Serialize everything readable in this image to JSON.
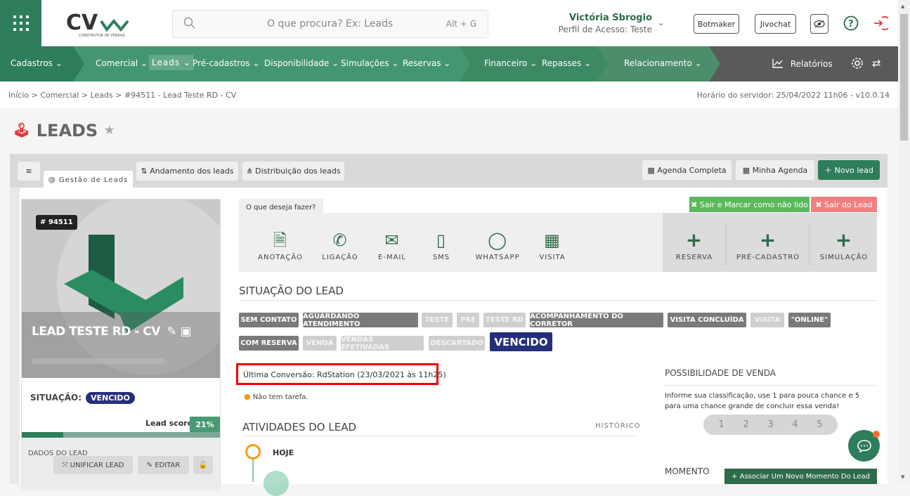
{
  "search": {
    "placeholder": "O que procura? Ex: Leads",
    "shortcut": "Alt + G"
  },
  "user": {
    "name": "Victória Sbrogio",
    "profile": "Perfil de Acesso: Teste"
  },
  "top_buttons": {
    "botmaker": "Botmaker",
    "jivochat": "Jivochat"
  },
  "nav": {
    "items": [
      "Cadastros",
      "Comercial",
      "Leads",
      "Pré-cadastros",
      "Disponibilidade",
      "Simulações",
      "Reservas",
      "Financeiro",
      "Repasses",
      "Relacionamento"
    ],
    "reports": "Relatórios"
  },
  "breadcrumb": {
    "path": "Início   >   Comercial   >   Leads   >   #94511 - Lead Teste RD - CV",
    "server": "Horário do servidor: 25/04/2022 11h06 - v10.0.14"
  },
  "page_title": "LEADS",
  "tabs": {
    "menu": "≡",
    "gestao": "@ Gestão de Leads",
    "andamento": "Andamento dos leads",
    "distribuicao": "Distribuição dos leads",
    "agenda": "Agenda Completa",
    "minha": "Minha Agenda",
    "novo": "Novo lead"
  },
  "lead": {
    "id": "# 94511",
    "name": "LEAD TESTE RD - CV",
    "situation_label": "SITUAÇÃO:",
    "situation": "VENCIDO",
    "score_label": "Lead score",
    "score": "21%",
    "score_value": 0.21,
    "section": "DADOS DO LEAD",
    "unify": "UNIFICAR LEAD",
    "edit": "EDITAR"
  },
  "actions": {
    "question": "O que deseja fazer?",
    "exit_mark": "Sair e Marcar como não lido",
    "exit": "Sair do Lead",
    "items": [
      "ANOTAÇÃO",
      "LIGAÇÃO",
      "E-MAIL",
      "SMS",
      "WHATSAPP",
      "VISITA"
    ],
    "right": [
      "RESERVA",
      "PRÉ-CADASTRO",
      "SIMULAÇÃO"
    ]
  },
  "situation_section": {
    "title": "SITUAÇÃO DO LEAD",
    "tags": [
      "SEM CONTATO",
      "AGUARDANDO ATENDIMENTO",
      "TESTE",
      "PRE",
      "TESTE RD",
      "ACOMPANHAMENTO DO CORRETOR",
      "VISITA CONCLUÍDA",
      "VISITA",
      "\"ONLINE\"",
      "COM RESERVA",
      "VENDA",
      "VENDAS EFETIVADAS",
      "DESCARTADO",
      "VENCIDO"
    ]
  },
  "conversion": "Última Conversão: RdStation (23/03/2021 às 11h25)",
  "task": "Não tem tarefa.",
  "activities": {
    "title": "ATIVIDADES DO LEAD",
    "history": "HISTÓRICO",
    "today": "HOJE"
  },
  "possibility": {
    "title": "POSSIBILIDADE DE VENDA",
    "text1": "Informe sua classificação, use 1 para pouca chance e 5",
    "text2": "para uma chance grande de concluir essa venda!",
    "ratings": [
      "1",
      "2",
      "3",
      "4",
      "5"
    ]
  },
  "moment": {
    "title": "MOMENTO",
    "button": "Associar Um Novo Momento Do Lead"
  },
  "colors": {
    "green": "#2e7d5b",
    "dark_navy": "#262f7a",
    "red": "#e53935"
  }
}
